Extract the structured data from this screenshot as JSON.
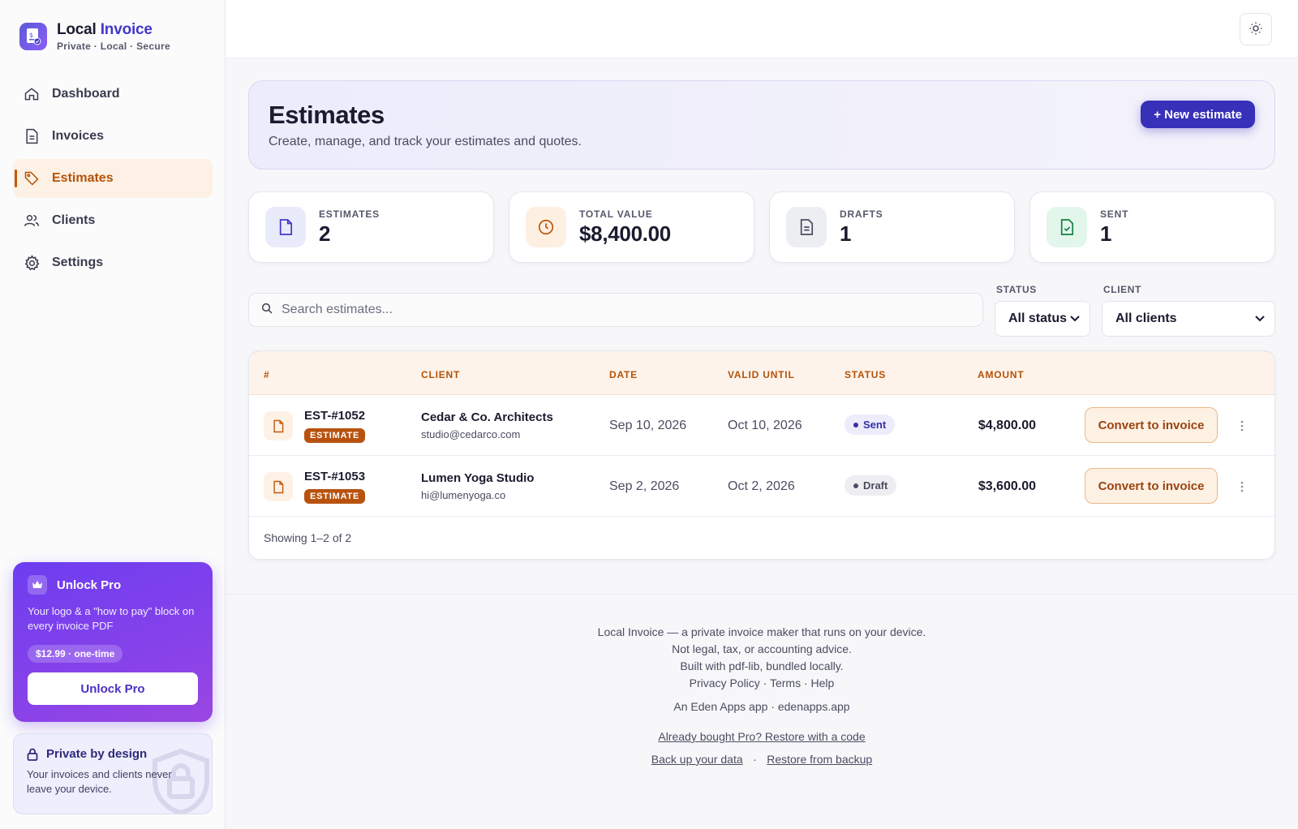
{
  "brand": {
    "name_part1": "Local",
    "name_part2": "Invoice",
    "tagline": "Private · Local · Secure"
  },
  "nav": {
    "items": [
      {
        "label": "Dashboard",
        "icon": "home-icon"
      },
      {
        "label": "Invoices",
        "icon": "document-icon"
      },
      {
        "label": "Estimates",
        "icon": "tag-icon",
        "active": true
      },
      {
        "label": "Clients",
        "icon": "users-icon"
      },
      {
        "label": "Settings",
        "icon": "gear-icon"
      }
    ]
  },
  "pro": {
    "title": "Unlock Pro",
    "desc": "Your logo & a \"how to pay\" block on every invoice PDF",
    "price": "$12.99 · one-time",
    "button": "Unlock Pro"
  },
  "private": {
    "title": "Private by design",
    "desc": "Your invoices and clients never leave your device."
  },
  "hero": {
    "title": "Estimates",
    "subtitle": "Create, manage, and track your estimates and quotes.",
    "new_button": "+ New estimate"
  },
  "stats": [
    {
      "label": "ESTIMATES",
      "value": "2",
      "icon": "document-icon"
    },
    {
      "label": "TOTAL VALUE",
      "value": "$8,400.00",
      "icon": "clock-icon"
    },
    {
      "label": "DRAFTS",
      "value": "1",
      "icon": "document-lines-icon"
    },
    {
      "label": "SENT",
      "value": "1",
      "icon": "document-check-icon"
    }
  ],
  "filters": {
    "search_placeholder": "Search estimates...",
    "status_label": "STATUS",
    "status_value": "All status",
    "client_label": "CLIENT",
    "client_value": "All clients"
  },
  "table": {
    "headers": {
      "num": "#",
      "client": "CLIENT",
      "date": "DATE",
      "valid": "VALID UNTIL",
      "status": "STATUS",
      "amount": "AMOUNT"
    },
    "rows": [
      {
        "number": "EST-#1052",
        "badge": "ESTIMATE",
        "client": "Cedar & Co. Architects",
        "email": "studio@cedarco.com",
        "date": "Sep 10, 2026",
        "valid": "Oct 10, 2026",
        "status": "Sent",
        "amount": "$4,800.00",
        "action": "Convert to invoice"
      },
      {
        "number": "EST-#1053",
        "badge": "ESTIMATE",
        "client": "Lumen Yoga Studio",
        "email": "hi@lumenyoga.co",
        "date": "Sep 2, 2026",
        "valid": "Oct 2, 2026",
        "status": "Draft",
        "amount": "$3,600.00",
        "action": "Convert to invoice"
      }
    ],
    "showing": "Showing 1–2 of 2"
  },
  "footer": {
    "line1": "Local Invoice — a private invoice maker that runs on your device.",
    "line2": "Not legal, tax, or accounting advice.",
    "line3": "Built with pdf-lib, bundled locally.",
    "line4": "Privacy Policy · Terms · Help",
    "line5": "An Eden Apps app · edenapps.app",
    "restore_code": "Already bought Pro? Restore with a code",
    "backup": "Back up your data",
    "separator": "·",
    "restore_backup": "Restore from backup"
  },
  "colors": {
    "accent": "#3730b8",
    "estimates_accent": "#c2580c",
    "pro_gradient": "#6d3df0"
  }
}
